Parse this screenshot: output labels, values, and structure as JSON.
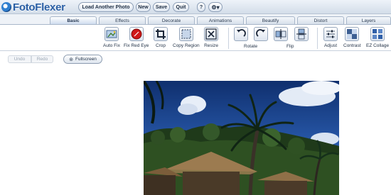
{
  "app": {
    "title": "FotoFlexer"
  },
  "topbar": {
    "load_label": "Load Another Photo",
    "new_label": "New",
    "save_label": "Save",
    "quit_label": "Quit",
    "help_label": "?",
    "settings_icon": "gear-icon"
  },
  "tabs": [
    {
      "label": "Basic",
      "active": true
    },
    {
      "label": "Effects",
      "active": false
    },
    {
      "label": "Decorate",
      "active": false
    },
    {
      "label": "Animations",
      "active": false
    },
    {
      "label": "Beautify",
      "active": false
    },
    {
      "label": "Distort",
      "active": false
    },
    {
      "label": "Layers",
      "active": false
    }
  ],
  "toolbar": {
    "auto_fix": "Auto Fix",
    "fix_red_eye": "Fix Red Eye",
    "crop": "Crop",
    "copy_region": "Copy Region",
    "resize": "Resize",
    "rotate": "Rotate",
    "flip": "Flip",
    "adjust": "Adjust",
    "contrast": "Contrast",
    "ez_collage": "EZ Collage"
  },
  "actions": {
    "undo_label": "Undo",
    "redo_label": "Redo",
    "fullscreen_label": "Fullscreen"
  },
  "colors": {
    "accent": "#2a5fa5",
    "red_eye": "#d01818"
  }
}
